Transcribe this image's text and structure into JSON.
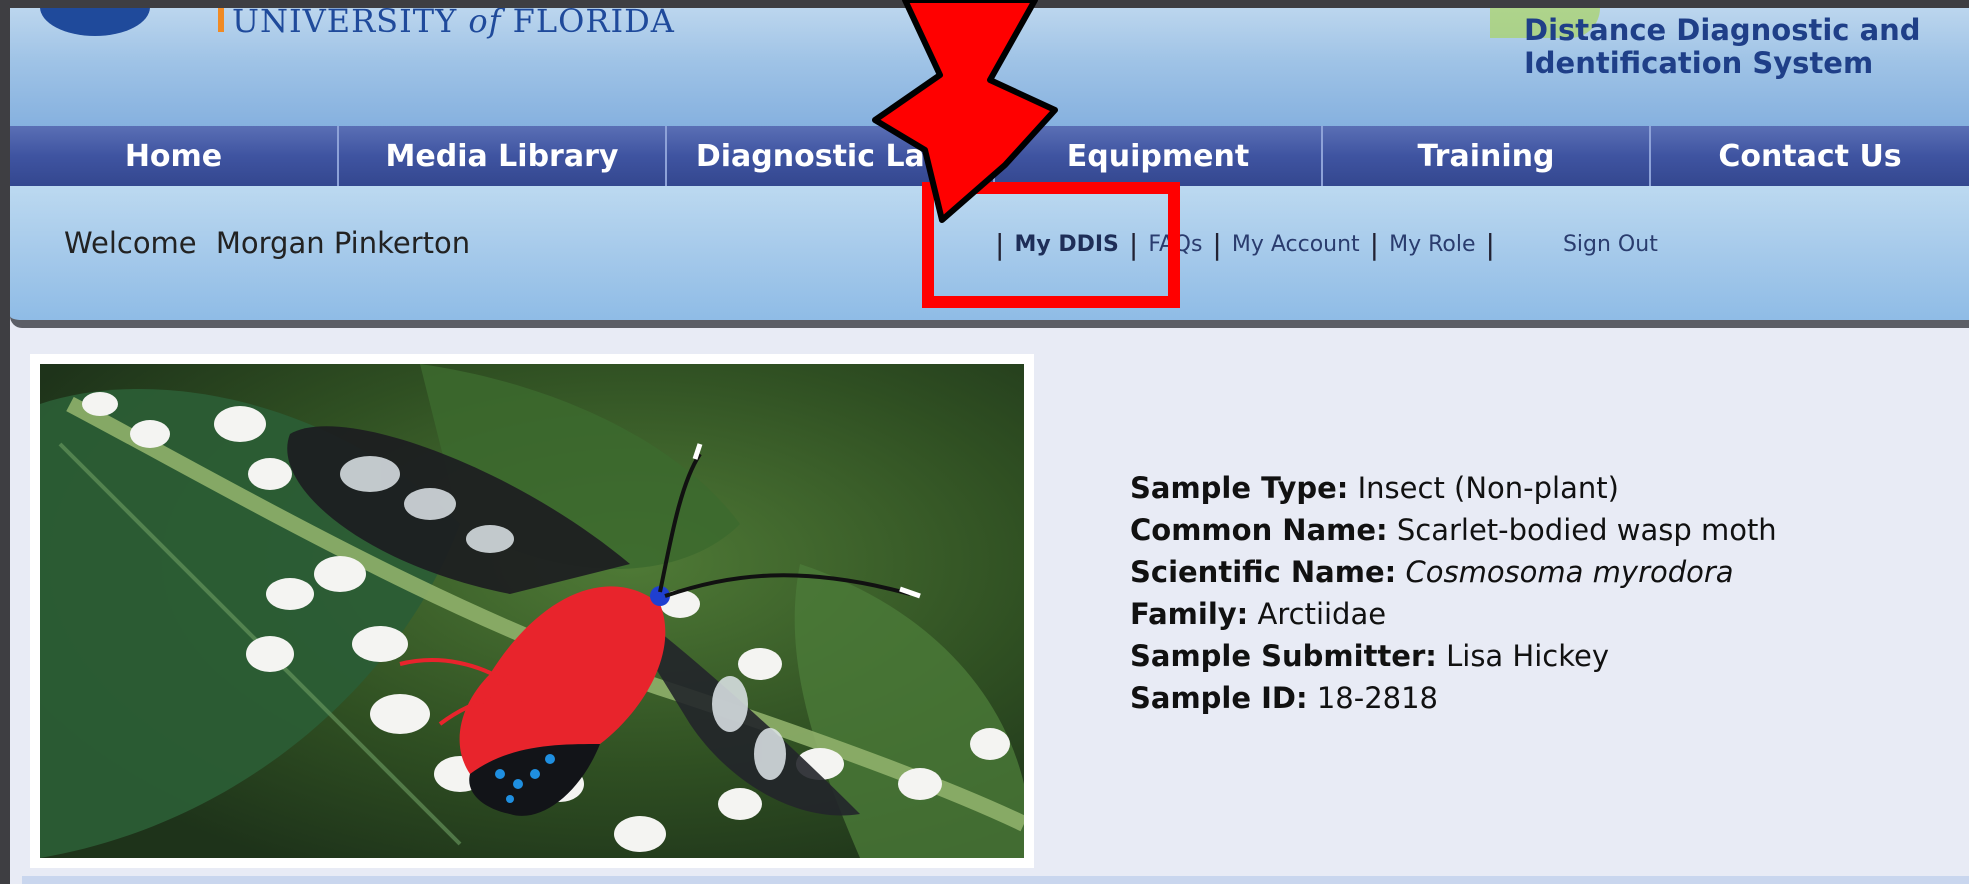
{
  "header": {
    "university_text_prefix": "UNIVERSITY",
    "university_text_of": "of",
    "university_text_suffix": "FLORIDA",
    "system_title_line1": "Distance Diagnostic and",
    "system_title_line2": "Identification System"
  },
  "nav": {
    "items": [
      {
        "label": "Home"
      },
      {
        "label": "Media Library"
      },
      {
        "label": "Diagnostic Labs"
      },
      {
        "label": "Equipment"
      },
      {
        "label": "Training"
      },
      {
        "label": "Contact Us"
      }
    ]
  },
  "user_bar": {
    "welcome_label": "Welcome",
    "user_name": "Morgan Pinkerton",
    "links": [
      {
        "label": "My DDIS"
      },
      {
        "label": "FAQs"
      },
      {
        "label": "My Account"
      },
      {
        "label": "My Role"
      }
    ],
    "sign_out": "Sign Out"
  },
  "sample": {
    "type_label": "Sample Type:",
    "type_value": "Insect (Non-plant)",
    "common_label": "Common Name:",
    "common_value": "Scarlet-bodied wasp moth",
    "scientific_label": "Scientific Name:",
    "scientific_value": "Cosmosoma myrodora",
    "family_label": "Family:",
    "family_value": "Arctiidae",
    "submitter_label": "Sample Submitter:",
    "submitter_value": "Lisa Hickey",
    "id_label": "Sample ID:",
    "id_value": "18-2818"
  },
  "colors": {
    "nav_bg": "#3f54a1",
    "header_bg": "#9fc3e6",
    "annotation_red": "#ff0000",
    "moth_body": "#e8242c"
  }
}
